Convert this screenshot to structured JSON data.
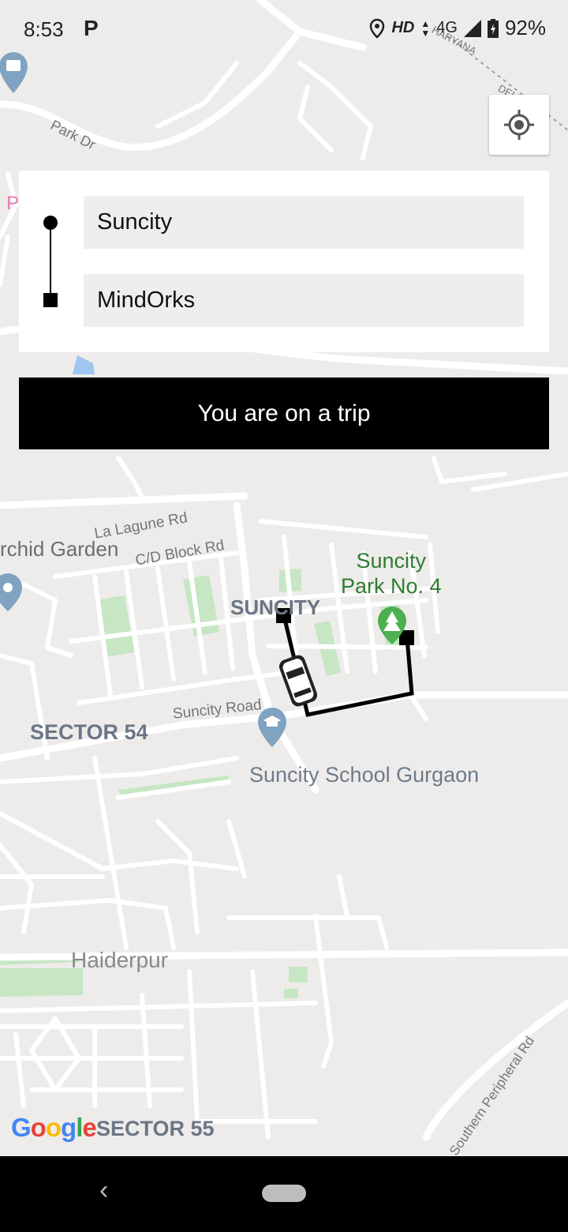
{
  "status_bar": {
    "time": "8:53",
    "notification_icon": "parking-p-icon",
    "network": "HD",
    "signal": "4G",
    "battery": "92%"
  },
  "trip": {
    "pickup": "Suncity",
    "drop": "MindOrks",
    "banner": "You are on a trip"
  },
  "map": {
    "labels": {
      "park_dr": "Park Dr",
      "haryana": "HARYANA",
      "delhi": "DELHI",
      "la_lagune": "La Lagune Rd",
      "orchid": "rchid Garden",
      "cd_block": "C/D Block Rd",
      "suncity_park_1": "Suncity",
      "suncity_park_2": "Park No. 4",
      "suncity_area": "SUNCITY",
      "suncity_road": "Suncity Road",
      "sector54": "SECTOR 54",
      "school": "Suncity School Gurgaon",
      "haiderpur": "Haiderpur",
      "sector55": "SECTOR 55",
      "southern": "Southern Peripheral Rd",
      "p_partial": "P"
    },
    "attribution": "Google",
    "colors": {
      "background": "#eeecea",
      "road": "#ffffff",
      "park": "#c6e6c4",
      "park_label": "#2e7d32",
      "label": "#757575",
      "route": "#000000"
    }
  },
  "icons": {
    "locate": "my-location-icon",
    "car": "car-icon",
    "tree": "park-tree-icon",
    "school": "school-cap-icon"
  },
  "nav_bar": {
    "back": "‹"
  }
}
